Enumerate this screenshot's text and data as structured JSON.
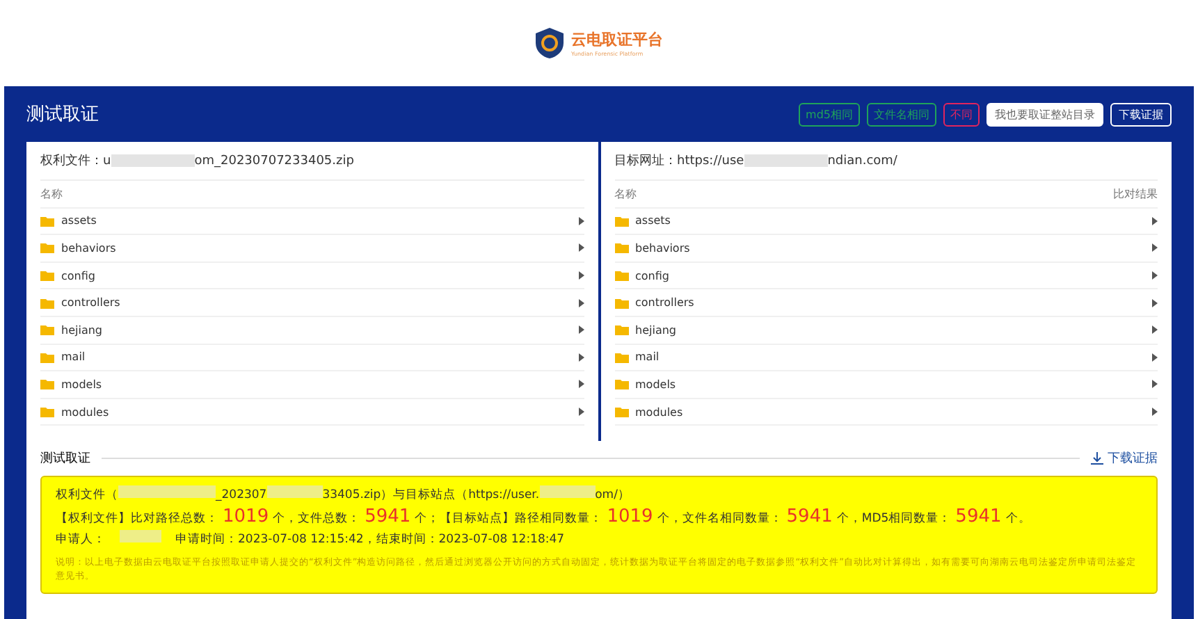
{
  "logo": {
    "title": "云电取证平台",
    "subtitle": "Yundian Forensic Platform"
  },
  "header": {
    "title": "测试取证",
    "legend": [
      {
        "label": "md5相同",
        "color": "#1fa35a"
      },
      {
        "label": "文件名相同",
        "color": "#1fa35a"
      },
      {
        "label": "不同",
        "color": "#e0245e"
      }
    ],
    "buttons": [
      {
        "label": "我也要取证整站目录",
        "kind": "primary"
      },
      {
        "label": "下载证据",
        "kind": "outline"
      }
    ]
  },
  "panels": [
    {
      "label": "权利文件：",
      "value_start": "u",
      "value_end": "om_20230707233405.zip",
      "column": "名称",
      "items": [
        "assets",
        "behaviors",
        "config",
        "controllers",
        "hejiang",
        "mail",
        "models",
        "modules"
      ]
    },
    {
      "label": "目标网址：",
      "value_start": "https://use",
      "value_end": "ndian.com/",
      "column": "名称",
      "result_column": "比对结果",
      "items": [
        "assets",
        "behaviors",
        "config",
        "controllers",
        "hejiang",
        "mail",
        "models",
        "modules"
      ]
    }
  ],
  "result": {
    "title": "测试取证",
    "download": "下载证据",
    "line1": [
      "权利文件（",
      "_202307",
      "33405.zip）与目标站点（https://user.",
      "om/）"
    ],
    "line2": [
      {
        "t": "【权利文件】比对路径总数：",
        "big": false
      },
      {
        "t": "1019",
        "big": true
      },
      {
        "t": "个，文件总数：",
        "big": false
      },
      {
        "t": "5941",
        "big": true
      },
      {
        "t": "个；【目标站点】路径相同数量：",
        "big": false
      },
      {
        "t": "1019",
        "big": true
      },
      {
        "t": "个，文件名相同数量：",
        "big": false
      },
      {
        "t": "5941",
        "big": true
      },
      {
        "t": "个，MD5相同数量：",
        "big": false
      },
      {
        "t": "5941",
        "big": true
      },
      {
        "t": "个。",
        "big": false
      }
    ],
    "applicant": "申请人：",
    "start": "申请时间：2023-07-08 12:15:42，结束时间：2023-07-08 12:18:47",
    "note": "说明：以上电子数据由云电取证平台按照取证申请人提交的“权利文件”构造访问路径，然后通过浏览器公开访问的方式自动固定，统计数据为取证平台将固定的电子数据参照“权利文件”自动比对计算得出，如有需要可向湖南云电司法鉴定所申请司法鉴定意见书。"
  }
}
